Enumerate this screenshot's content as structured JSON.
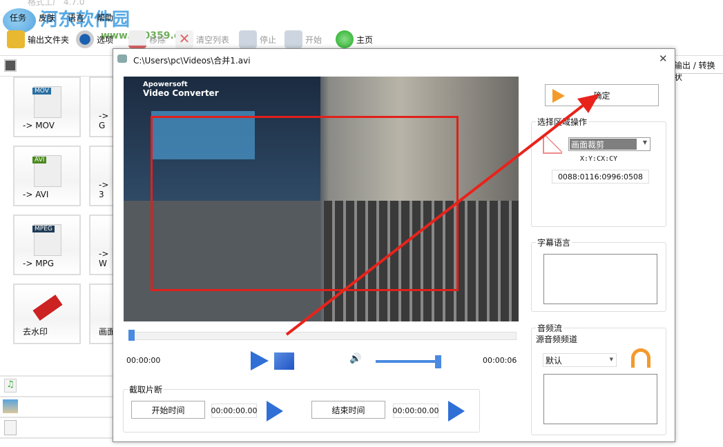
{
  "app": {
    "title": "格式工厂 4.7.0",
    "watermark": "河东软件园",
    "watermark_url": "www.pc0359.cn"
  },
  "menu": [
    "任务",
    "皮肤",
    "语言",
    "帮助"
  ],
  "toolbar": [
    {
      "label": "输出文件夹",
      "enabled": true
    },
    {
      "label": "选项",
      "enabled": true
    },
    {
      "label": "移除",
      "enabled": false
    },
    {
      "label": "清空列表",
      "enabled": false
    },
    {
      "label": "停止",
      "enabled": false
    },
    {
      "label": "开始",
      "enabled": false
    },
    {
      "label": "主页",
      "enabled": true
    }
  ],
  "right_header": "输出 / 转换状",
  "tiles": [
    {
      "label": "-> MOV",
      "tag": "MOV",
      "color": "#2a6ea0"
    },
    {
      "label": "-> AVI",
      "tag": "AVI",
      "color": "#4a8a1e"
    },
    {
      "label": "-> MPG",
      "tag": "MPEG",
      "color": "#1f3b55"
    },
    {
      "label": "去水印",
      "tag": "",
      "color": "#c22"
    }
  ],
  "tiles_col2": [
    "-> G",
    "-> 3",
    "-> W",
    "画面"
  ],
  "dialog": {
    "title": "C:\\Users\\pc\\Videos\\合并1.avi",
    "video_overlay": {
      "brand": "Apowersoft",
      "product": "Video Converter"
    },
    "time_current": "00:00:00",
    "time_total": "00:00:06",
    "seek_progress": 0.0,
    "volume": 0.95,
    "clip": {
      "title": "截取片断",
      "start_label": "开始时间",
      "start_value": "00:00:00.00",
      "end_label": "结束时间",
      "end_value": "00:00:00.00"
    },
    "confirm": "确定",
    "region": {
      "title": "选择区域操作",
      "mode": "画面裁剪",
      "coord_label": "X:Y:CX:CY",
      "coords": "0088:0116:0996:0508"
    },
    "subtitle": {
      "title": "字幕语言"
    },
    "audio": {
      "title": "音频流",
      "source_label": "源音频频道",
      "source_value": "默认"
    }
  }
}
